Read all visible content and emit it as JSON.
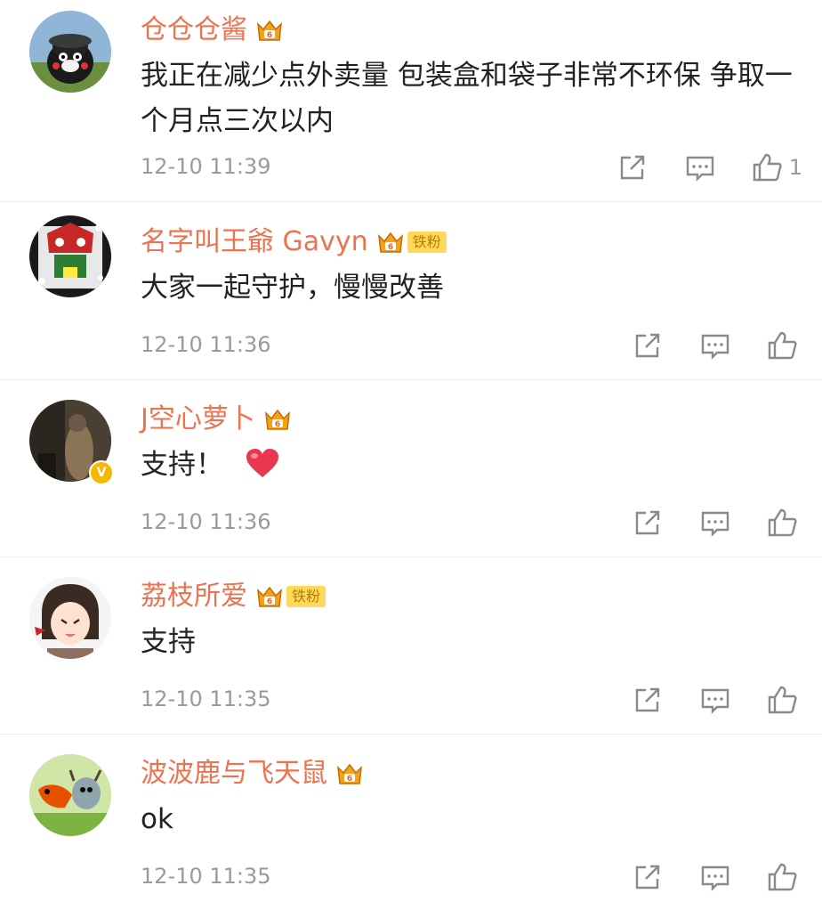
{
  "colors": {
    "username": "#eb7350",
    "content": "#222222",
    "meta": "#9a9a9a",
    "vip_gold": "#f2a31b",
    "fan_badge_bg": "#ffd95c",
    "v_badge": "#f6b800",
    "heart": "#e8384d"
  },
  "comments": [
    {
      "username": "仓仓仓酱",
      "content": "我正在减少点外卖量 包装盒和袋子非常不环保 争取一个月点三次以内",
      "timestamp": "12-10 11:39",
      "like_count": "1",
      "fan_badge": ""
    },
    {
      "username": "名字叫王爺 Gavyn",
      "content": "大家一起守护，慢慢改善",
      "timestamp": "12-10 11:36",
      "like_count": "",
      "fan_badge": "铁粉"
    },
    {
      "username": "J空心萝卜",
      "content": "支持！",
      "timestamp": "12-10 11:36",
      "like_count": "",
      "fan_badge": "",
      "verified_badge": "V"
    },
    {
      "username": "荔枝所爱",
      "content": "支持",
      "timestamp": "12-10 11:35",
      "like_count": "",
      "fan_badge": "铁粉"
    },
    {
      "username": "波波鹿与飞天鼠",
      "content": "ok",
      "timestamp": "12-10 11:35",
      "like_count": "",
      "fan_badge": ""
    }
  ],
  "icons": {
    "forward": "share-external-icon",
    "reply": "comment-bubble-icon",
    "like": "thumbs-up-icon",
    "vip": "crown-vip-icon",
    "heart": "red-heart-emoji"
  }
}
